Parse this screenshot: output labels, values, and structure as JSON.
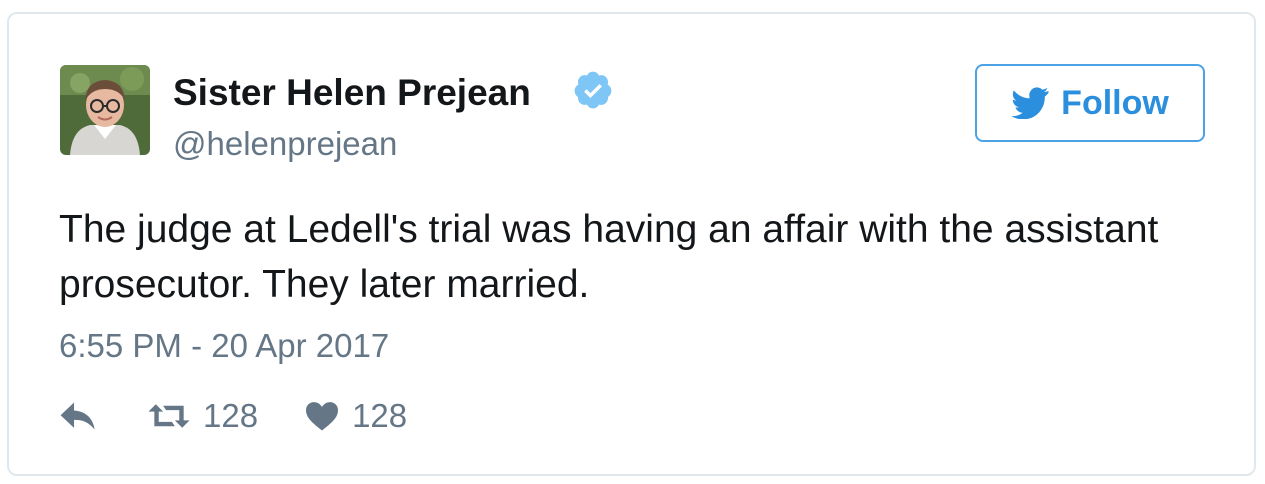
{
  "user": {
    "name": "Sister Helen Prejean",
    "handle": "@helenprejean",
    "avatar_icon": "profile-photo",
    "verified_icon": "verified-badge-icon"
  },
  "follow_button": {
    "label": "Follow",
    "icon": "twitter-bird-icon"
  },
  "tweet": {
    "text": "The judge at Ledell's trial was having an affair with the assistant prosecutor. They later married.",
    "timestamp": "6:55 PM - 20 Apr 2017"
  },
  "actions": {
    "reply_icon": "reply-icon",
    "retweet_icon": "retweet-icon",
    "retweet_count": "128",
    "like_icon": "heart-icon",
    "like_count": "128"
  },
  "colors": {
    "brand_blue": "#1da1f2",
    "follow_text": "#2b8fde",
    "text_primary": "#14171a",
    "text_secondary": "#657786",
    "border": "#e1e8ed"
  }
}
